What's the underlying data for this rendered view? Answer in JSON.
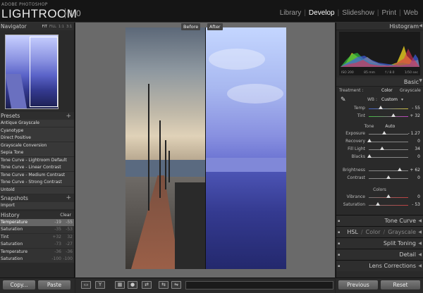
{
  "app": {
    "brand_small": "ADOBE PHOTOSHOP",
    "brand_big": "LIGHTROOM",
    "version": "1.0"
  },
  "modules": [
    {
      "label": "Library",
      "active": false
    },
    {
      "label": "Develop",
      "active": true
    },
    {
      "label": "Slideshow",
      "active": false
    },
    {
      "label": "Print",
      "active": false
    },
    {
      "label": "Web",
      "active": false
    }
  ],
  "navigator": {
    "title": "Navigator",
    "controls": [
      "FIT",
      "FILL",
      "1:1",
      "3:1"
    ]
  },
  "presets": {
    "title": "Presets",
    "items": [
      "Antique Grayscale",
      "Cyanotype",
      "Direct Positive",
      "Grayscale Conversion",
      "Sepia Tone",
      "Tone Curve - Lightroom Default",
      "Tone Curve - Linear Contrast",
      "Tone Curve - Medium Contrast",
      "Tone Curve - Strong Contrast",
      "Untold"
    ]
  },
  "snapshots": {
    "title": "Snapshots",
    "items": [
      "Import"
    ]
  },
  "history": {
    "title": "History",
    "clear_label": "Clear",
    "rows": [
      {
        "name": "Temperature",
        "a": "-19",
        "b": "-55"
      },
      {
        "name": "Saturation",
        "a": "-35",
        "b": "-53"
      },
      {
        "name": "Tint",
        "a": "+32",
        "b": "32"
      },
      {
        "name": "Saturation",
        "a": "-73",
        "b": "-27"
      },
      {
        "name": "Temperature",
        "a": "-36",
        "b": "-36"
      },
      {
        "name": "Saturation",
        "a": "-100",
        "b": "-100"
      }
    ]
  },
  "compare": {
    "before": "Before",
    "after": "After"
  },
  "left_buttons": {
    "copy": "Copy...",
    "paste": "Paste"
  },
  "histogram": {
    "title": "Histogram",
    "iso": "ISO 200",
    "focal": "85 mm",
    "aperture": "f / 8.0",
    "shutter": "1/50 sec"
  },
  "basic": {
    "title": "Basic",
    "treatment_label": "Treatment :",
    "treatment_color": "Color",
    "treatment_gray": "Grayscale",
    "wb_label": "WB :",
    "wb_value": "Custom",
    "temp": {
      "label": "Temp",
      "value": "- 55",
      "pos": 0.3
    },
    "tint": {
      "label": "Tint",
      "value": "+ 32",
      "pos": 0.62
    },
    "tone_label": "Tone",
    "auto_label": "Auto",
    "exposure": {
      "label": "Exposure",
      "value": "- 1.27",
      "pos": 0.4
    },
    "recovery": {
      "label": "Recovery",
      "value": "0",
      "pos": 0.02
    },
    "fill_light": {
      "label": "Fill Light",
      "value": "34",
      "pos": 0.34
    },
    "blacks": {
      "label": "Blacks",
      "value": "0",
      "pos": 0.02
    },
    "brightness": {
      "label": "Brightness",
      "value": "+ 62",
      "pos": 0.78
    },
    "contrast": {
      "label": "Contrast",
      "value": "0",
      "pos": 0.5
    },
    "presence_label": "Colors",
    "vibrance": {
      "label": "Vibrance",
      "value": "0",
      "pos": 0.5
    },
    "saturation": {
      "label": "Saturation",
      "value": "- 53",
      "pos": 0.24
    }
  },
  "panels": [
    "Tone Curve",
    "HSL",
    "Color",
    "Grayscale",
    "Split Toning",
    "Detail",
    "Lens Corrections"
  ],
  "right_buttons": {
    "previous": "Previous",
    "reset": "Reset"
  }
}
